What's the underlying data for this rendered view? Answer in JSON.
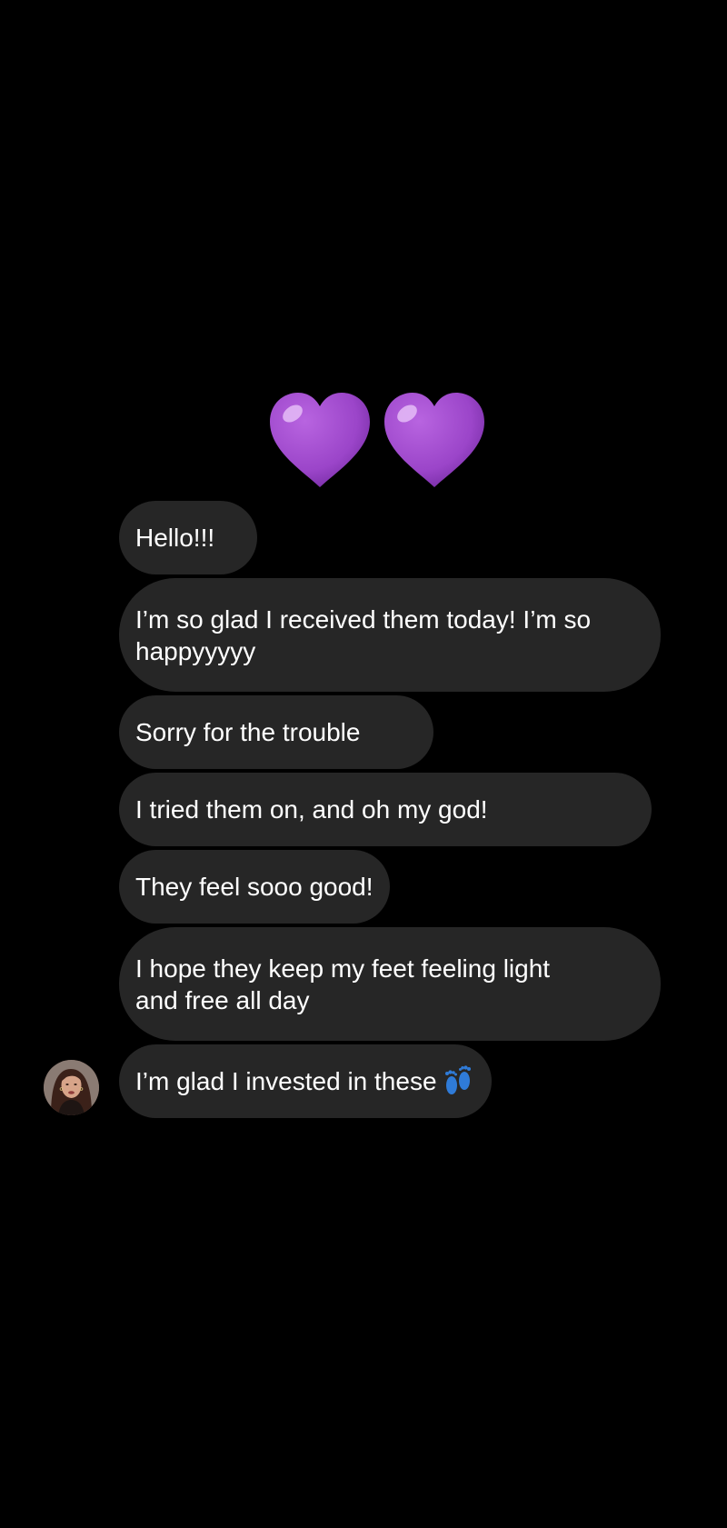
{
  "reaction": {
    "emoji": "💜💜",
    "icon": "purple-heart-icon",
    "color": "#9b45c9"
  },
  "messages": [
    {
      "text": "Hello!!!"
    },
    {
      "text": "I’m so glad I received them today! I’m so happyyyyy"
    },
    {
      "text": "Sorry for the trouble"
    },
    {
      "text": "I tried them on, and oh my god!"
    },
    {
      "text": "They feel sooo good!"
    },
    {
      "text": "I hope they keep my feet feeling light and free all day"
    },
    {
      "text": "I’m glad I invested in these",
      "emoji": "👣",
      "emoji_icon": "footprints-icon"
    }
  ],
  "colors": {
    "background": "#000000",
    "bubble": "#262626",
    "text": "#ffffff"
  }
}
